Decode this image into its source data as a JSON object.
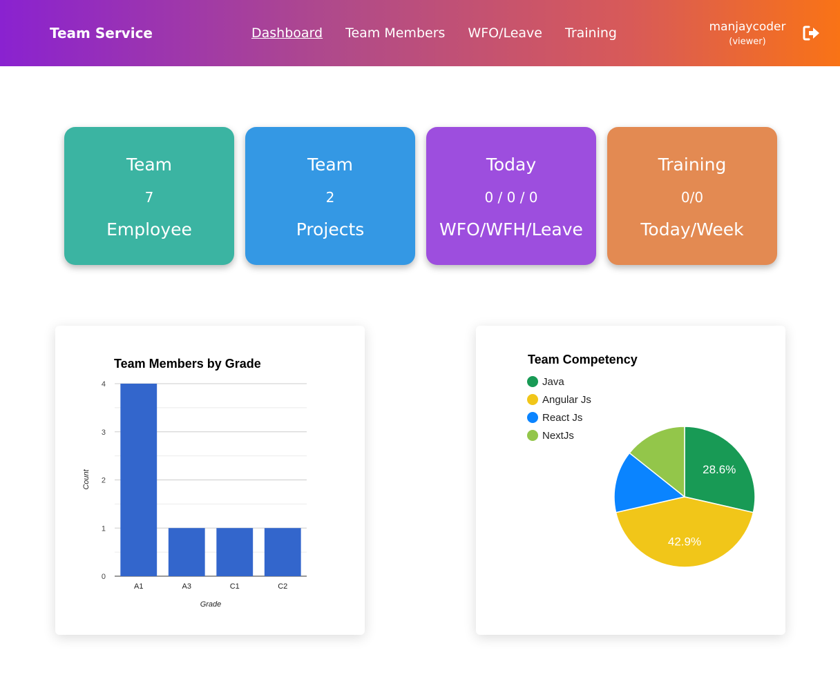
{
  "nav": {
    "brand": "Team Service",
    "links": [
      "Dashboard",
      "Team Members",
      "WFO/Leave",
      "Training"
    ],
    "active_index": 0,
    "user": {
      "name": "manjaycoder",
      "role": "(viewer)"
    }
  },
  "cards": [
    {
      "title": "Team",
      "value": "7",
      "subtitle": "Employee",
      "color": "#3bb4a2"
    },
    {
      "title": "Team",
      "value": "2",
      "subtitle": "Projects",
      "color": "#3498e4"
    },
    {
      "title": "Today",
      "value": "0 / 0 / 0",
      "subtitle": "WFO/WFH/Leave",
      "color": "#9d4ede"
    },
    {
      "title": "Training",
      "value": "0/0",
      "subtitle": "Today/Week",
      "color": "#e38a52"
    }
  ],
  "chart_data": [
    {
      "type": "bar",
      "title": "Team Members by Grade",
      "xlabel": "Grade",
      "ylabel": "Count",
      "categories": [
        "A1",
        "A3",
        "C1",
        "C2"
      ],
      "values": [
        4,
        1,
        1,
        1
      ],
      "ylim": [
        0,
        4
      ],
      "yticks": [
        "0",
        "1",
        "2",
        "3",
        "4"
      ],
      "grid": true,
      "color": "#3366cc"
    },
    {
      "type": "pie",
      "title": "Team Competency",
      "legend_position": "top-left",
      "slices": [
        {
          "label": "Java",
          "value": 2,
          "color": "#189a55",
          "data_label": "28.6%"
        },
        {
          "label": "Angular Js",
          "value": 3,
          "color": "#f1c619",
          "data_label": "42.9%"
        },
        {
          "label": "React Js",
          "value": 1,
          "color": "#0a84ff",
          "data_label": ""
        },
        {
          "label": "NextJs",
          "value": 1,
          "color": "#93c64a",
          "data_label": ""
        }
      ]
    }
  ]
}
